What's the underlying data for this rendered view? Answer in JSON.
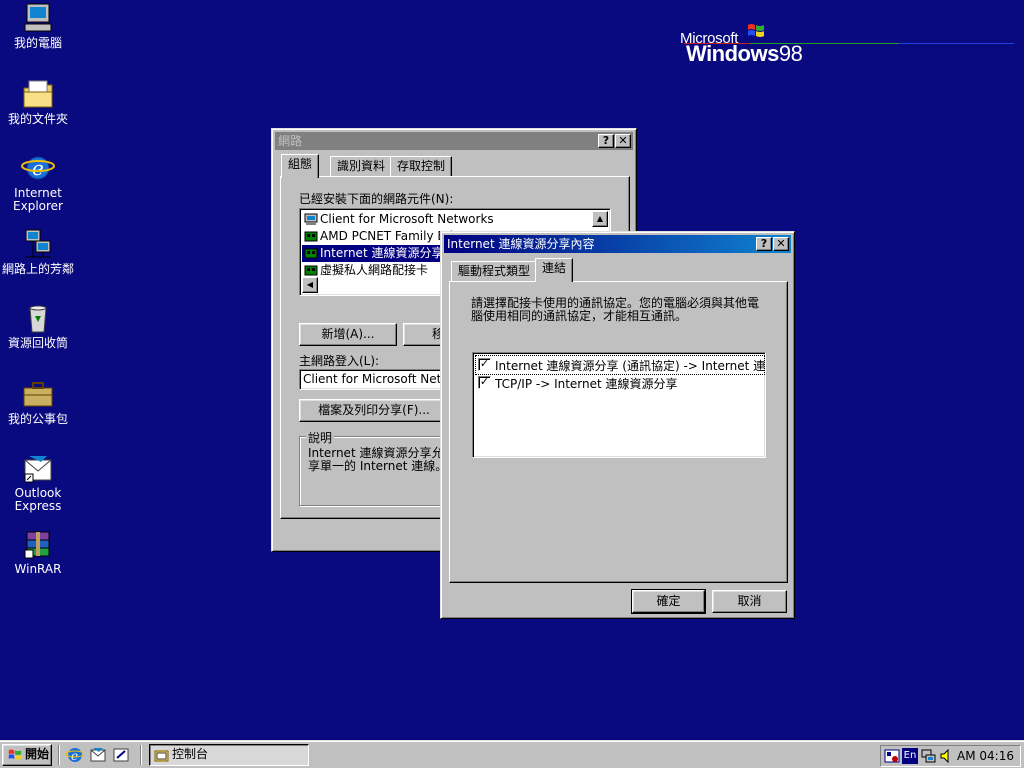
{
  "desktop": {
    "icons": [
      {
        "label": "我的電腦",
        "icon": "my-computer-icon"
      },
      {
        "label": "我的文件夾",
        "icon": "my-documents-icon"
      },
      {
        "label": "Internet Explorer",
        "icon": "internet-explorer-icon"
      },
      {
        "label": "網路上的芳鄰",
        "icon": "network-neighborhood-icon"
      },
      {
        "label": "資源回收筒",
        "icon": "recycle-bin-icon"
      },
      {
        "label": "我的公事包",
        "icon": "briefcase-icon"
      },
      {
        "label": "Outlook Express",
        "icon": "outlook-express-icon"
      },
      {
        "label": "WinRAR",
        "icon": "winrar-icon"
      }
    ],
    "logo": {
      "microsoft": "Microsoft",
      "windows": "Windows",
      "version": "98"
    }
  },
  "network_window": {
    "title": "網路",
    "tabs": [
      "組態",
      "識別資料",
      "存取控制"
    ],
    "installed_label": "已經安裝下面的網路元件(N):",
    "components": [
      {
        "label": "Client for Microsoft Networks",
        "icon": "client-icon"
      },
      {
        "label": "AMD PCNET Family Ethe",
        "icon": "adapter-icon"
      },
      {
        "label": "Internet 連線資源分享",
        "icon": "adapter-icon"
      },
      {
        "label": "虛擬私人網路配接卡",
        "icon": "adapter-icon"
      }
    ],
    "add_button": "新增(A)...",
    "remove_button_partial": "移",
    "primary_logon_label": "主網路登入(L):",
    "primary_logon_value": "Client for Microsoft Network",
    "file_print_button": "檔案及列印分享(F)...",
    "description_label": "說明",
    "description_text": "Internet 連線資源分享允許\n享單一的 Internet 連線。"
  },
  "ics_dialog": {
    "title": "Internet 連線資源分享內容",
    "tabs": [
      "驅動程式類型",
      "連結"
    ],
    "instruction": "請選擇配接卡使用的通訊協定。您的電腦必須與其他電\n腦使用相同的通訊協定，才能相互通訊。",
    "bindings": [
      {
        "label": "Internet 連線資源分享 (通訊協定) -> Internet 連線資源",
        "checked": true
      },
      {
        "label": "TCP/IP -> Internet 連線資源分享",
        "checked": true
      }
    ],
    "ok_button": "確定",
    "cancel_button": "取消"
  },
  "taskbar": {
    "start_label": "開始",
    "task_label": "控制台",
    "clock": "AM 04:16",
    "lang": "En"
  },
  "colors": {
    "desktop": "#0a0a80",
    "active_title": "#000080",
    "inactive_title": "#808080",
    "selection": "#000080"
  }
}
